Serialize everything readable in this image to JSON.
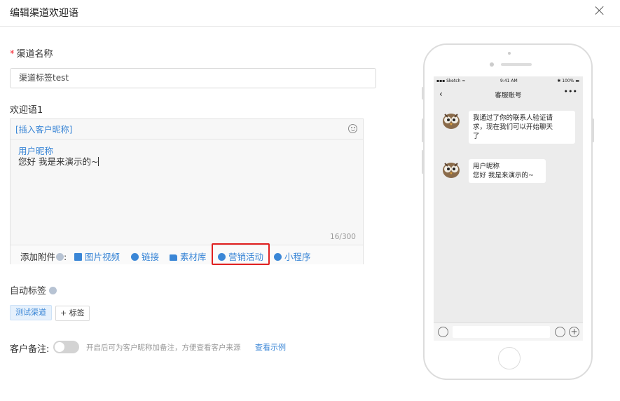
{
  "dialog": {
    "title": "编辑渠道欢迎语"
  },
  "channel_name": {
    "required_mark": "*",
    "label": "渠道名称",
    "value": "渠道标签test"
  },
  "welcome": {
    "label": "欢迎语1",
    "insert_nickname": "[插入客户昵称]",
    "nickname_text": "用户昵称",
    "message_text": "您好 我是来演示的~",
    "char_count": "16/300",
    "attachments": {
      "label": "添加附件",
      "colon": ":",
      "items": [
        {
          "label": "图片视频",
          "icon": "image-icon"
        },
        {
          "label": "链接",
          "icon": "link-icon"
        },
        {
          "label": "素材库",
          "icon": "folder-icon"
        },
        {
          "label": "营销活动",
          "icon": "campaign-icon"
        },
        {
          "label": "小程序",
          "icon": "mini-program-icon"
        }
      ]
    }
  },
  "auto_tag": {
    "label": "自动标签",
    "tags": [
      "测试渠道"
    ],
    "add_button": "+ 标签"
  },
  "customer_note": {
    "label": "客户备注:",
    "enabled": false,
    "hint": "开启后可为客户昵称加备注，方便查看客户来源",
    "example_link": "查看示例"
  },
  "preview": {
    "status_left": "Sketch",
    "status_time": "9:41 AM",
    "status_battery": "100%",
    "nav_title": "客服账号",
    "nav_more": "•••",
    "messages": [
      {
        "text_lines": [
          "我通过了你的联系人验证请",
          "求，现在我们可以开始聊天",
          "了"
        ]
      },
      {
        "text_lines": [
          "用户昵称",
          "您好 我是来演示的~"
        ]
      }
    ]
  },
  "colors": {
    "accent": "#3a86d6",
    "highlight_border": "#e02020",
    "required": "#f5222d"
  }
}
